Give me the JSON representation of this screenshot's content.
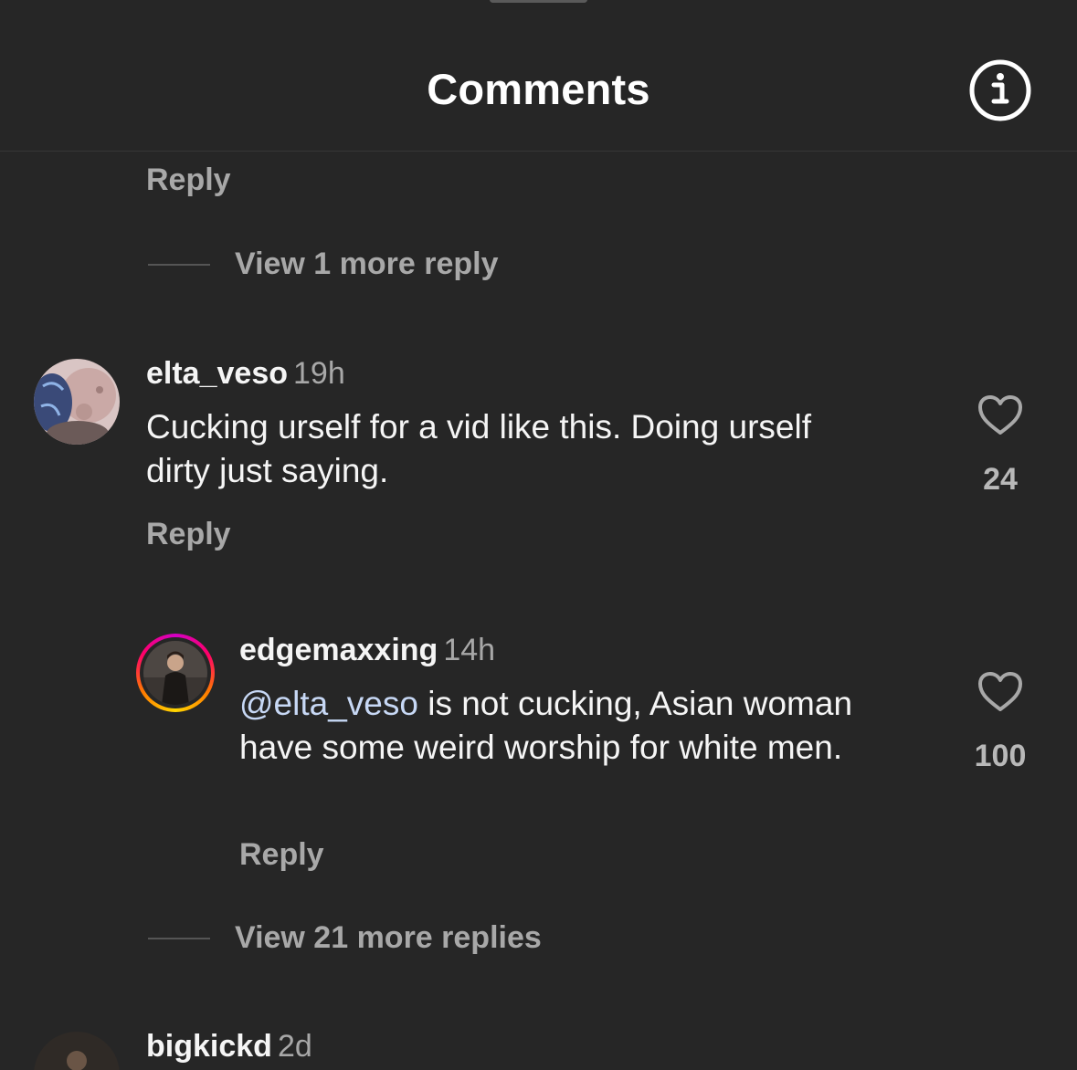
{
  "header": {
    "title": "Comments",
    "info_icon": "info-icon"
  },
  "thread1": {
    "reply_label": "Reply",
    "view_more": "View 1 more reply"
  },
  "comment_elta": {
    "username": "elta_veso",
    "time": "19h",
    "text": "Cucking urself for a vid like this. Doing urself dirty just saying.",
    "likes": "24",
    "reply_label": "Reply"
  },
  "reply_edge": {
    "username": "edgemaxxing",
    "time": "14h",
    "mention": "@elta_veso",
    "text": " is not cucking, Asian woman have some weird worship for white men.",
    "likes": "100",
    "reply_label": "Reply"
  },
  "thread2": {
    "view_more": "View 21 more replies"
  },
  "comment_big": {
    "username": "bigkickd",
    "time": "2d"
  },
  "colors": {
    "background": "#262626",
    "muted_text": "#a8a8a8",
    "mention": "#c7d8f5"
  }
}
